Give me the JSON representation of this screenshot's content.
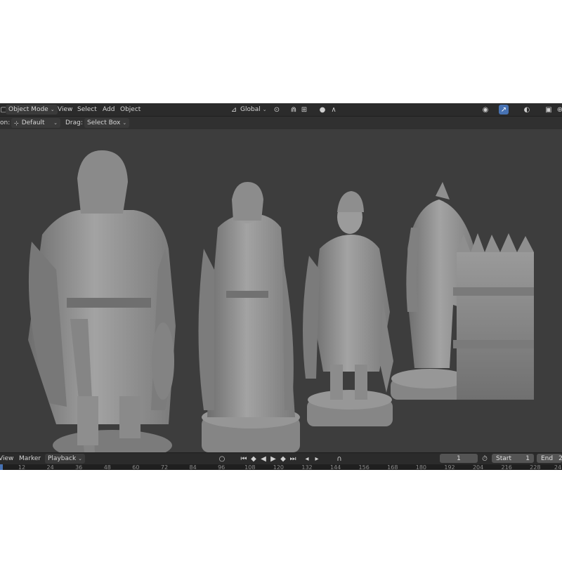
{
  "header": {
    "mode": "Object Mode",
    "menus": [
      "View",
      "Select",
      "Add",
      "Object"
    ],
    "orientation": "Global"
  },
  "tool_settings": {
    "orientation_label": "on:",
    "pivot": "Default",
    "drag_label": "Drag:",
    "drag_value": "Select Box"
  },
  "timeline": {
    "menus": [
      "View",
      "Marker",
      "Playback"
    ],
    "current_frame": "1",
    "start_label": "Start",
    "start_value": "1",
    "end_label": "End",
    "end_value": "2",
    "ruler_ticks": [
      "12",
      "24",
      "36",
      "48",
      "60",
      "72",
      "84",
      "96",
      "108",
      "120",
      "132",
      "144",
      "156",
      "168",
      "180",
      "192",
      "204",
      "216",
      "228",
      "24"
    ]
  },
  "colors": {
    "viewport_bg": "#3d3d3d",
    "header_bg": "#2b2b2b",
    "accent": "#4772b3",
    "model": "#8f8f8f"
  },
  "viewport": {
    "objects": [
      "viking-king-figure",
      "viking-queen-figure",
      "viking-warrior-figure",
      "horse-knight-figure",
      "palisade-rook-figure"
    ]
  }
}
